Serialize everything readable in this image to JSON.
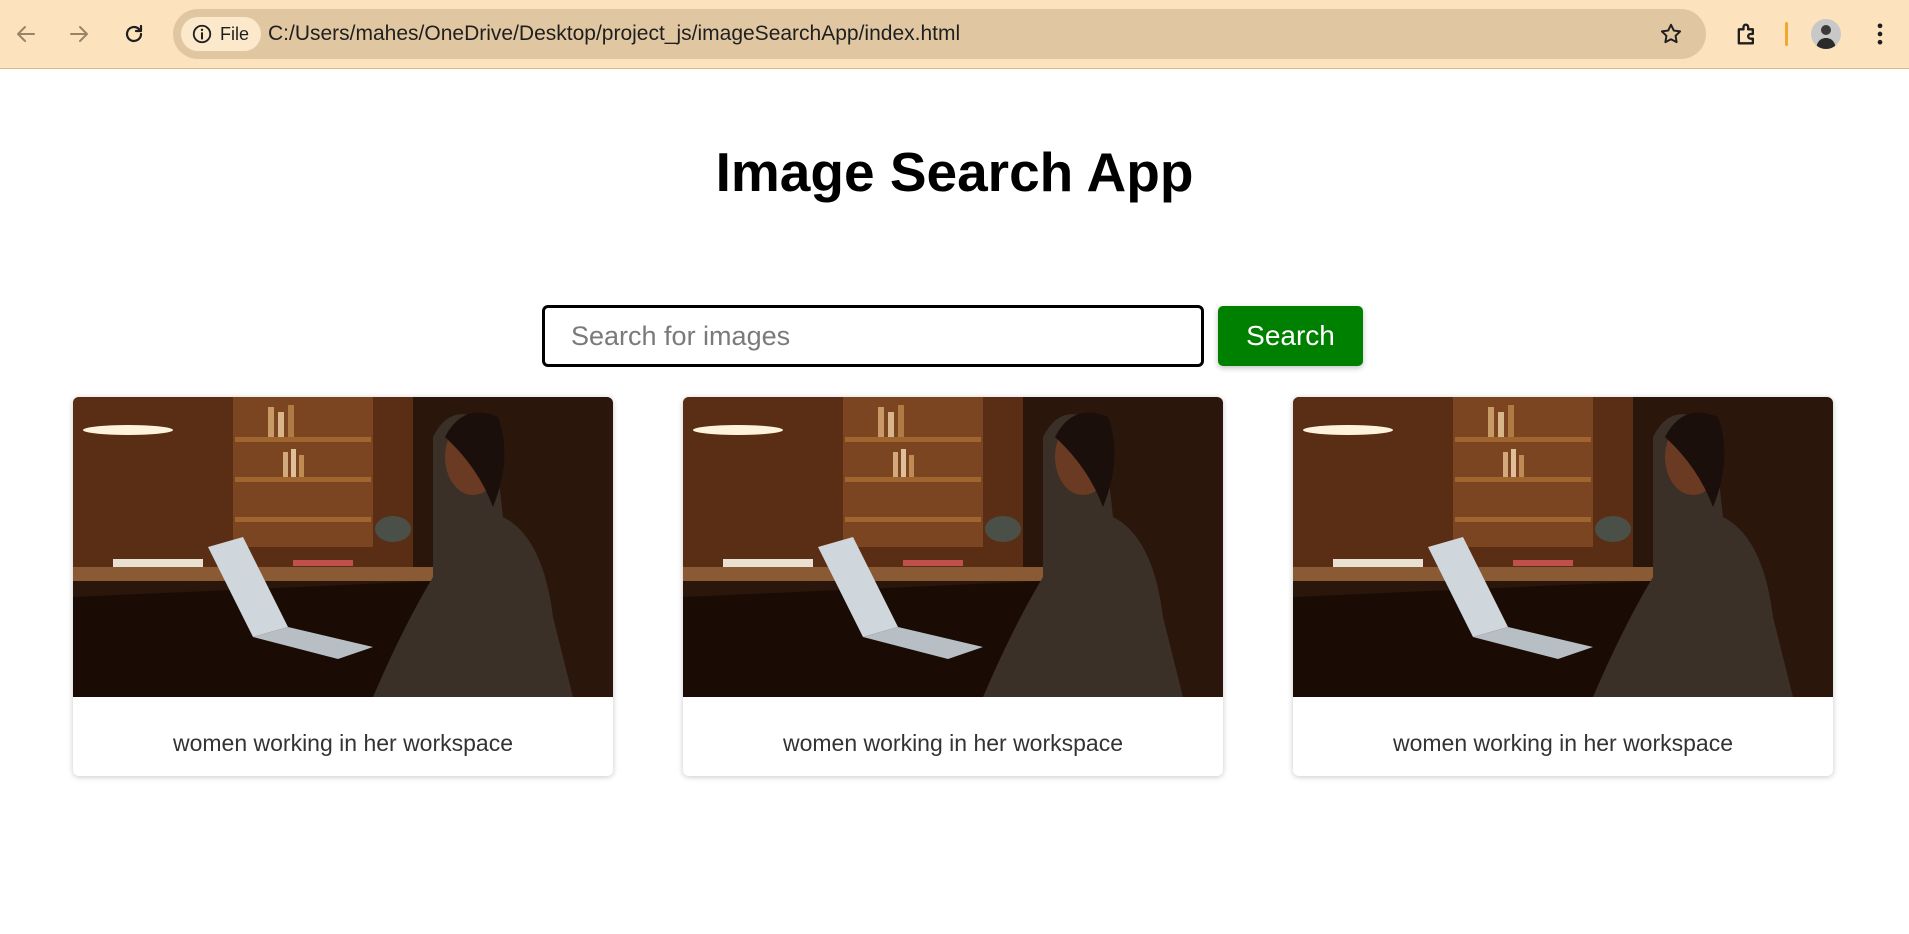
{
  "browser": {
    "site_chip": "File",
    "url": "C:/Users/mahes/OneDrive/Desktop/project_js/imageSearchApp/index.html",
    "accent_separator": "#f0a830"
  },
  "page": {
    "title": "Image Search App",
    "search": {
      "placeholder": "Search for images",
      "value": "",
      "button_label": "Search",
      "button_color": "#008000"
    },
    "results": [
      {
        "caption": "women working in her workspace",
        "image_alt": "women working in her workspace"
      },
      {
        "caption": "women working in her workspace",
        "image_alt": "women working in her workspace"
      },
      {
        "caption": "women working in her workspace",
        "image_alt": "women working in her workspace"
      }
    ]
  }
}
